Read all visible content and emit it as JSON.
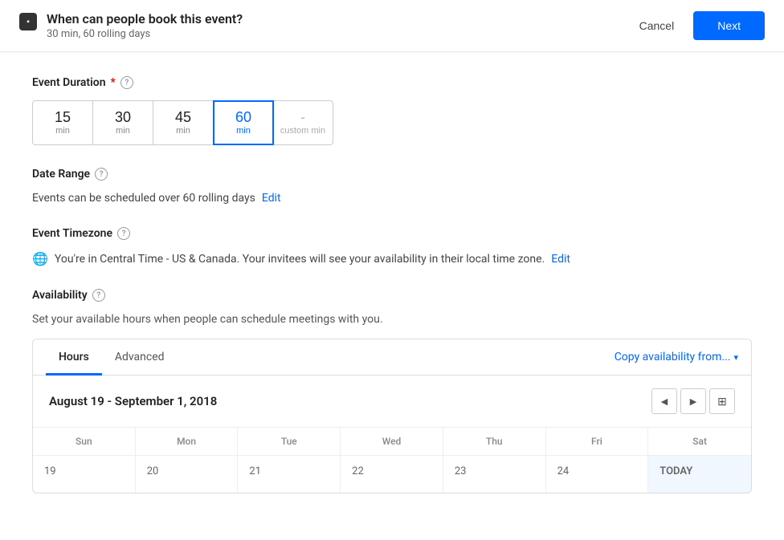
{
  "header": {
    "icon_label": "event-icon",
    "title": "When can people book this event?",
    "subtitle": "30 min, 60 rolling days",
    "cancel_label": "Cancel",
    "next_label": "Next"
  },
  "event_duration": {
    "label": "Event Duration",
    "required": true,
    "help": "?",
    "options": [
      {
        "value": "15",
        "unit": "min",
        "selected": false
      },
      {
        "value": "30",
        "unit": "min",
        "selected": false
      },
      {
        "value": "45",
        "unit": "min",
        "selected": false
      },
      {
        "value": "60",
        "unit": "min",
        "selected": true
      },
      {
        "value": "-",
        "unit": "custom min",
        "selected": false
      }
    ]
  },
  "date_range": {
    "label": "Date Range",
    "help": "?",
    "text": "Events can be scheduled over 60 rolling days",
    "edit_label": "Edit"
  },
  "event_timezone": {
    "label": "Event Timezone",
    "help": "?",
    "text": "You're in Central Time - US & Canada. Your invitees will see your availability in their local time zone.",
    "edit_label": "Edit"
  },
  "availability": {
    "label": "Availability",
    "help": "?",
    "description": "Set your available hours when people can schedule meetings with you.",
    "tabs": [
      {
        "id": "hours",
        "label": "Hours",
        "active": true
      },
      {
        "id": "advanced",
        "label": "Advanced",
        "active": false
      }
    ],
    "copy_availability_label": "Copy availability from...",
    "calendar": {
      "title": "August 19 - September 1, 2018",
      "prev_label": "◀",
      "next_label": "▶",
      "days": [
        "Sun",
        "Mon",
        "Tue",
        "Wed",
        "Thu",
        "Fri",
        "Sat"
      ],
      "dates": [
        {
          "value": "19",
          "today": false
        },
        {
          "value": "20",
          "today": false
        },
        {
          "value": "21",
          "today": false
        },
        {
          "value": "22",
          "today": false
        },
        {
          "value": "23",
          "today": false
        },
        {
          "value": "24",
          "today": false
        },
        {
          "value": "",
          "today": true,
          "today_label": "TODAY"
        }
      ]
    }
  }
}
